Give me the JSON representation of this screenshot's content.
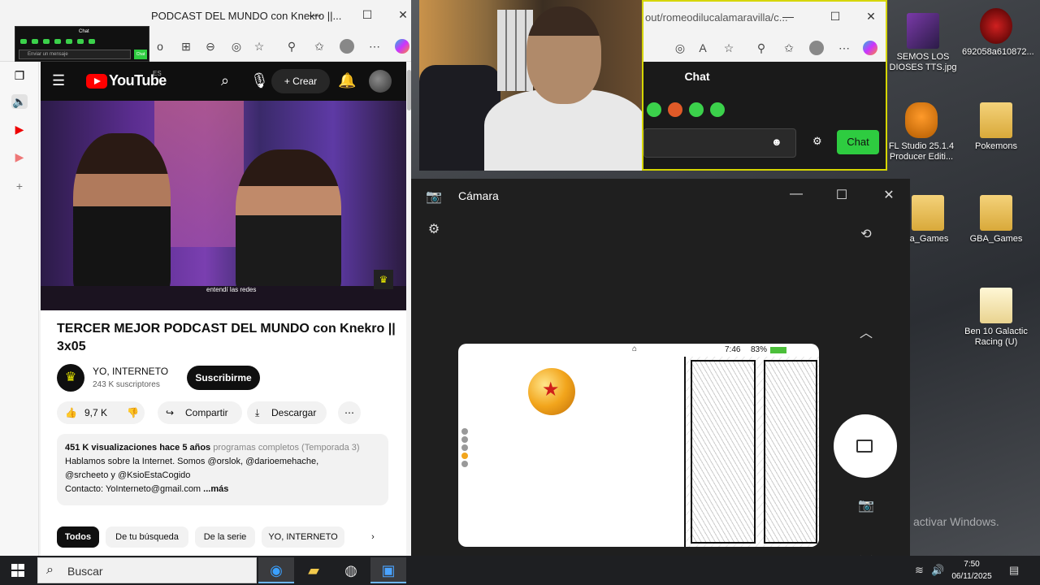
{
  "desktop": {
    "icons": [
      {
        "label": "SEMOS LOS DIOSES TTS.jpg"
      },
      {
        "label": "692058a610872..."
      },
      {
        "label": "FL Studio 25.1.4 Producer Editi..."
      },
      {
        "label": "Pokemons"
      },
      {
        "label": "ta_Games"
      },
      {
        "label": "GBA_Games"
      },
      {
        "label": "Ben 10 Galactic Racing (U)"
      }
    ],
    "activate_text": "activar Windows."
  },
  "browser1": {
    "tab_title": "PODCAST DEL MUNDO con Knekro ||..."
  },
  "mini_overlay": {
    "title": "Chat",
    "placeholder": "Enviar un mensaje",
    "button": "Chat"
  },
  "youtube": {
    "logo": "YouTube",
    "region": "ES",
    "create_label": "Crear",
    "video_caption": "entendí las redes",
    "title": "TERCER MEJOR PODCAST DEL MUNDO con Knekro || 3x05",
    "channel": "YO, INTERNETO",
    "subscribers": "243 K suscriptores",
    "subscribe_label": "Suscribirme",
    "likes": "9,7 K",
    "share_label": "Compartir",
    "download_label": "Descargar",
    "description": {
      "views": "451 K visualizaciones",
      "age": "hace 5 años",
      "tags": "programas completos (Temporada 3)",
      "line2": "Hablamos sobre la Internet. Somos @orslok, @darioemehache,",
      "line3": "@srcheeto y @KsioEstaCogido",
      "line4": "Contacto: YoInterneto@gmail.com",
      "more": "...más"
    },
    "chips": [
      "Todos",
      "De tu búsqueda",
      "De la serie",
      "YO, INTERNETO"
    ]
  },
  "browser2": {
    "address": "out/romeodilucalamaravilla/c...",
    "chat_title": "Chat",
    "chat_button": "Chat"
  },
  "camera_app": {
    "title": "Cámara",
    "preview_time": "7:46",
    "preview_battery": "83%"
  },
  "taskbar": {
    "search_placeholder": "Buscar",
    "time": "7:50",
    "date": "06/11/2025"
  }
}
